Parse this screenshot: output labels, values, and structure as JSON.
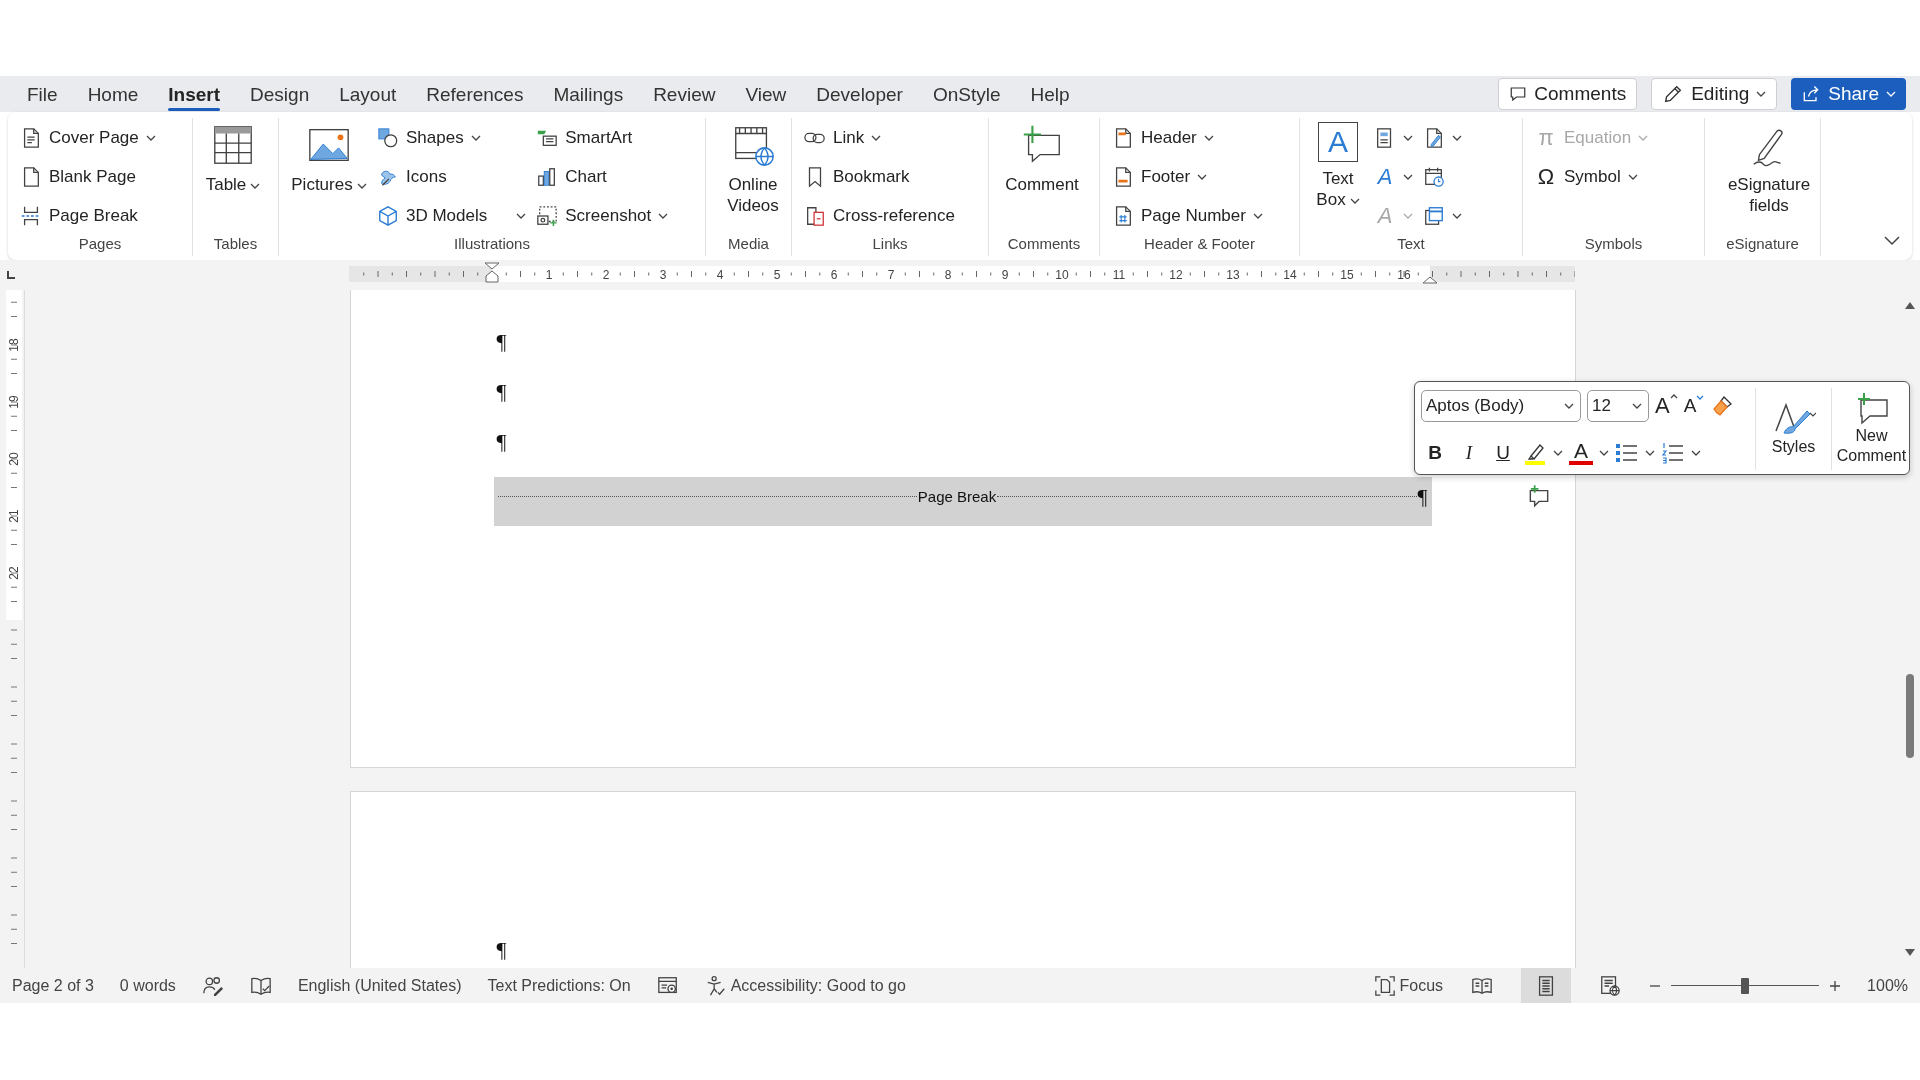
{
  "tabs": [
    {
      "label": "File",
      "selected": false
    },
    {
      "label": "Home",
      "selected": false
    },
    {
      "label": "Insert",
      "selected": true
    },
    {
      "label": "Design",
      "selected": false
    },
    {
      "label": "Layout",
      "selected": false
    },
    {
      "label": "References",
      "selected": false
    },
    {
      "label": "Mailings",
      "selected": false
    },
    {
      "label": "Review",
      "selected": false
    },
    {
      "label": "View",
      "selected": false
    },
    {
      "label": "Developer",
      "selected": false
    },
    {
      "label": "OnStyle",
      "selected": false
    },
    {
      "label": "Help",
      "selected": false
    }
  ],
  "actions": [
    {
      "label": "Comments",
      "kind": "outline",
      "dropdown": false
    },
    {
      "label": "Editing",
      "kind": "outline",
      "dropdown": true
    },
    {
      "label": "Share",
      "kind": "primary",
      "dropdown": true
    }
  ],
  "ribbon": {
    "groups": [
      {
        "label": "Pages",
        "columns": [
          [
            {
              "kind": "small",
              "label": "Cover Page",
              "dropdown": true
            },
            {
              "kind": "small",
              "label": "Blank Page",
              "dropdown": false
            },
            {
              "kind": "small",
              "label": "Page Break",
              "dropdown": false
            }
          ]
        ]
      },
      {
        "label": "Tables",
        "columns": [
          [
            {
              "kind": "large",
              "label": "Table",
              "dropdown": true
            }
          ]
        ]
      },
      {
        "label": "Illustrations",
        "columns": [
          [
            {
              "kind": "large",
              "label": "Pictures",
              "dropdown": true
            }
          ],
          [
            {
              "kind": "small",
              "label": "Shapes",
              "dropdown": true
            },
            {
              "kind": "small",
              "label": "Icons",
              "dropdown": false
            },
            {
              "kind": "small",
              "label": "3D Models",
              "dropdown": true
            }
          ],
          [
            {
              "kind": "small",
              "label": "SmartArt",
              "dropdown": false
            },
            {
              "kind": "small",
              "label": "Chart",
              "dropdown": false
            },
            {
              "kind": "small",
              "label": "Screenshot",
              "dropdown": true
            }
          ]
        ]
      },
      {
        "label": "Media",
        "columns": [
          [
            {
              "kind": "large",
              "label": "Online Videos",
              "dropdown": false
            }
          ]
        ]
      },
      {
        "label": "Links",
        "columns": [
          [
            {
              "kind": "small",
              "label": "Link",
              "dropdown": true
            },
            {
              "kind": "small",
              "label": "Bookmark",
              "dropdown": false
            },
            {
              "kind": "small",
              "label": "Cross-reference",
              "dropdown": false
            }
          ]
        ]
      },
      {
        "label": "Comments",
        "columns": [
          [
            {
              "kind": "large",
              "label": "Comment",
              "dropdown": false
            }
          ]
        ]
      },
      {
        "label": "Header & Footer",
        "columns": [
          [
            {
              "kind": "small",
              "label": "Header",
              "dropdown": true
            },
            {
              "kind": "small",
              "label": "Footer",
              "dropdown": true
            },
            {
              "kind": "small",
              "label": "Page Number",
              "dropdown": true
            }
          ]
        ]
      },
      {
        "label": "Text",
        "columns": [
          [
            {
              "kind": "large",
              "label": "Text Box",
              "glyph": "A",
              "dropdown": true
            }
          ],
          [
            {
              "kind": "icon",
              "dropdown": true
            },
            {
              "kind": "icon",
              "glyph": "A",
              "dropdown": true
            },
            {
              "kind": "icon",
              "glyph": "A",
              "dropdown": true,
              "disabled": true
            }
          ],
          [
            {
              "kind": "icon",
              "dropdown": true
            },
            {
              "kind": "icon",
              "dropdown": false
            },
            {
              "kind": "icon",
              "dropdown": true
            }
          ]
        ]
      },
      {
        "label": "Symbols",
        "columns": [
          [
            {
              "kind": "small",
              "label": "Equation",
              "glyph": "π",
              "dropdown": true,
              "disabled": true
            },
            {
              "kind": "small",
              "label": "Symbol",
              "glyph": "Ω",
              "dropdown": true
            }
          ]
        ]
      },
      {
        "label": "eSignature",
        "columns": [
          [
            {
              "kind": "large",
              "label": "eSignature fields",
              "dropdown": false
            }
          ]
        ]
      }
    ]
  },
  "ruler": {
    "horizontal": [
      "1",
      "2",
      "3",
      "4",
      "5",
      "6",
      "7",
      "8",
      "9",
      "10",
      "11",
      "12",
      "13",
      "14",
      "15",
      "16"
    ],
    "vertical": [
      "18",
      "19",
      "20",
      "21",
      "22"
    ]
  },
  "pages": [
    {
      "paragraphs": [
        "¶",
        "¶",
        "¶"
      ],
      "page_break": {
        "label": "Page Break",
        "mark": "¶"
      }
    },
    {
      "paragraphs": [
        "¶"
      ]
    }
  ],
  "mini_toolbar": {
    "font": "Aptos (Body)",
    "size": "12",
    "grow": "A",
    "shrink": "A",
    "format": [
      "B",
      "I",
      "U"
    ],
    "font_color": "A",
    "styles": "Styles",
    "new_comment": "New Comment"
  },
  "status_bar": {
    "left": [
      {
        "kind": "text",
        "label": "Page 2 of 3"
      },
      {
        "kind": "text",
        "label": "0 words"
      },
      {
        "kind": "icon"
      },
      {
        "kind": "icon"
      },
      {
        "kind": "text",
        "label": "English (United States)"
      },
      {
        "kind": "text",
        "label": "Text Predictions: On"
      },
      {
        "kind": "icon"
      },
      {
        "kind": "icon_text",
        "label": "Accessibility: Good to go"
      }
    ],
    "focus": "Focus",
    "views": [
      {
        "selected": false
      },
      {
        "selected": true
      },
      {
        "selected": false
      }
    ],
    "zoom": {
      "level": 0.5,
      "reading": "100%"
    }
  }
}
